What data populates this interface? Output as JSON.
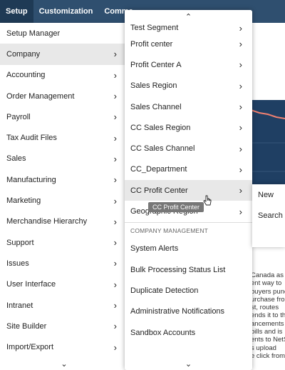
{
  "topbar": {
    "tabs": [
      "Setup",
      "Customization",
      "Comme",
      "",
      ""
    ]
  },
  "left_menu": {
    "items": [
      {
        "label": "Setup Manager",
        "arrow": false
      },
      {
        "label": "Company",
        "arrow": true
      },
      {
        "label": "Accounting",
        "arrow": true
      },
      {
        "label": "Order Management",
        "arrow": true
      },
      {
        "label": "Payroll",
        "arrow": true
      },
      {
        "label": "Tax Audit Files",
        "arrow": true
      },
      {
        "label": "Sales",
        "arrow": true
      },
      {
        "label": "Manufacturing",
        "arrow": true
      },
      {
        "label": "Marketing",
        "arrow": true
      },
      {
        "label": "Merchandise Hierarchy",
        "arrow": true
      },
      {
        "label": "Support",
        "arrow": true
      },
      {
        "label": "Issues",
        "arrow": true
      },
      {
        "label": "User Interface",
        "arrow": true
      },
      {
        "label": "Intranet",
        "arrow": true
      },
      {
        "label": "Site Builder",
        "arrow": true
      },
      {
        "label": "Import/Export",
        "arrow": true
      }
    ],
    "selected": "Company"
  },
  "submenu": {
    "items": [
      {
        "label": "Test Segment"
      },
      {
        "label": "Profit center"
      },
      {
        "label": "Profit Center A"
      },
      {
        "label": "Sales Region"
      },
      {
        "label": "Sales Channel"
      },
      {
        "label": "CC Sales Region"
      },
      {
        "label": "CC Sales Channel"
      },
      {
        "label": "CC_Department"
      },
      {
        "label": "CC Profit Center"
      },
      {
        "label": "Geographic Region"
      }
    ],
    "hovered": "CC Profit Center",
    "section_title": "COMPANY MANAGEMENT",
    "section_items": [
      {
        "label": "System Alerts"
      },
      {
        "label": "Bulk Processing Status List"
      },
      {
        "label": "Duplicate Detection"
      },
      {
        "label": "Administrative Notifications"
      },
      {
        "label": "Sandbox Accounts"
      }
    ]
  },
  "tooltip": "CC Profit Center",
  "flyout": {
    "items": [
      "New",
      "Search"
    ]
  },
  "background_text": [
    "Canada as",
    "ent way to",
    "buyers punc",
    "urchase fro",
    "st, routes",
    "ends it to th",
    "ancements",
    "bills and is",
    "ents to NetS",
    "s upload",
    "e click from"
  ],
  "colors": {
    "topbar": "#2f4f6f",
    "topbar_active": "#1f3a55",
    "chart_bg": "#1f3f63",
    "chart_line": "#f08070",
    "hover": "#e8e8e8"
  },
  "icons": {
    "chevron_right": "›",
    "chevron_up": "⌃",
    "chevron_down": "⌄"
  }
}
